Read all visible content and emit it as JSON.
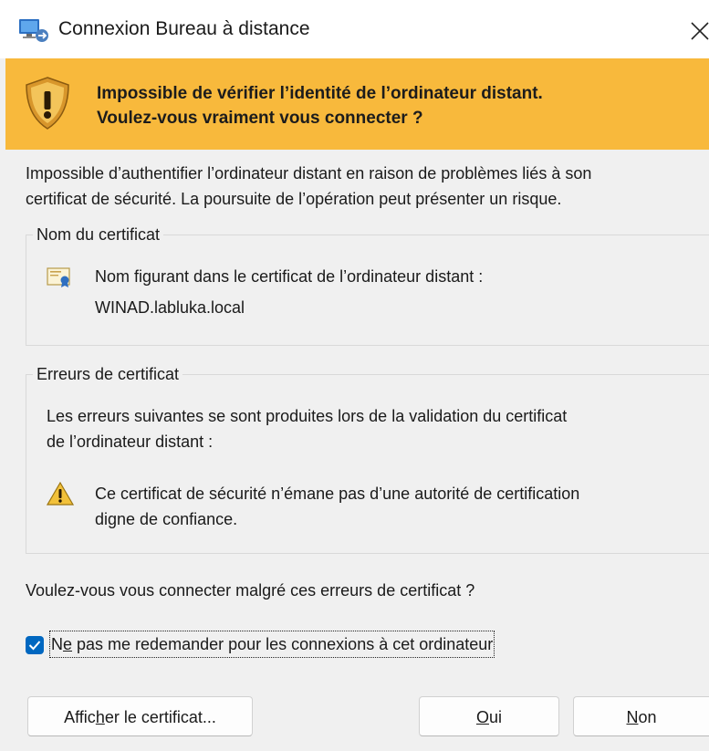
{
  "window": {
    "title": "Connexion Bureau à distance",
    "app_icon": "remote-desktop-icon",
    "close_icon": "close-icon"
  },
  "banner": {
    "color": "#f8b93c",
    "icon": "warning-shield-icon",
    "line1": "Impossible de vérifier l’identité de l’ordinateur distant.",
    "line2": "Voulez-vous vraiment vous connecter ?"
  },
  "intro": {
    "line1": "Impossible d’authentifier l’ordinateur distant en raison de problèmes liés à son",
    "line2": "certificat de sécurité. La poursuite de l’opération peut présenter un risque."
  },
  "certificate_name": {
    "legend": "Nom du certificat",
    "icon": "certificate-icon",
    "label": "Nom figurant dans le certificat de l’ordinateur distant :",
    "value": "WINAD.labluka.local"
  },
  "certificate_errors": {
    "legend": "Erreurs de certificat",
    "intro_line1": "Les erreurs suivantes se sont produites lors de la validation du certificat",
    "intro_line2": "de l’ordinateur distant :",
    "icon": "warning-icon",
    "item_line1": "Ce certificat de sécurité n’émane pas d’une autorité de certification",
    "item_line2": "digne de confiance."
  },
  "question": "Voulez-vous vous connecter malgré ces erreurs de certificat ?",
  "checkbox": {
    "checked": true,
    "label_before": "N",
    "label_mnemonic": "e",
    "label_after": " pas me redemander pour les connexions à cet ordinateur",
    "accent": "#0067c0"
  },
  "buttons": {
    "view_before": "Affic",
    "view_mnemonic": "h",
    "view_after": "er le certificat...",
    "yes_mnemonic": "O",
    "yes_after": "ui",
    "no_mnemonic": "N",
    "no_after": "on"
  }
}
